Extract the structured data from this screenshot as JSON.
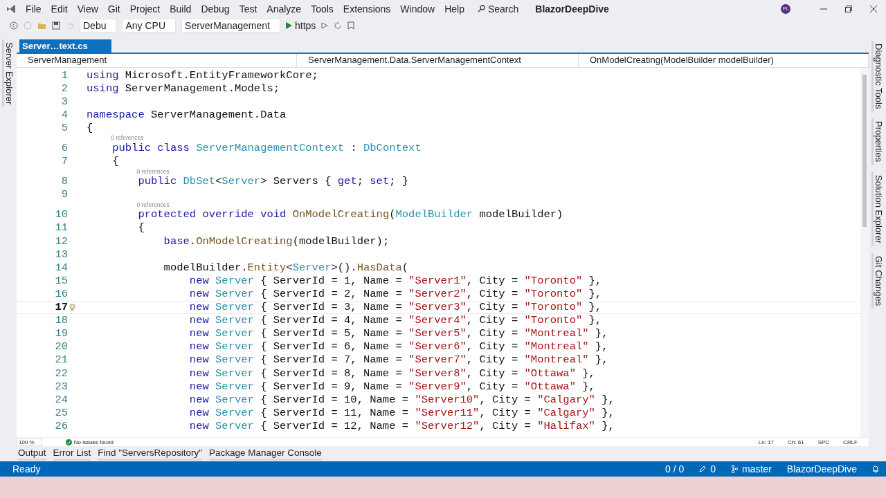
{
  "menu_bar": {
    "items": [
      "File",
      "Edit",
      "View",
      "Git",
      "Project",
      "Build",
      "Debug",
      "Test",
      "Analyze",
      "Tools",
      "Extensions",
      "Window",
      "Help"
    ],
    "search": "Search",
    "solution": "BlazorDeepDive",
    "avatar": "FL"
  },
  "toolbar": {
    "configuration": "Debu",
    "platform": "Any CPU",
    "startup_project": "ServerManagement",
    "run_profile": "https"
  },
  "left_tabs": [
    "Server Explorer"
  ],
  "document_tabs": [
    {
      "label": "Server…text.cs",
      "selected": true
    }
  ],
  "navigation_bar": [
    "ServerManagement",
    "ServerManagement.Data.ServerManagementContext",
    "OnModelCreating(ModelBuilder modelBuilder)"
  ],
  "editor": {
    "lines": [
      {
        "number": "1",
        "current": false,
        "tokens": [
          {
            "kind": "kw",
            "t": "using"
          },
          {
            "kind": "plain",
            "t": " Microsoft.EntityFrameworkCore;"
          }
        ]
      },
      {
        "number": "2",
        "current": false,
        "tokens": [
          {
            "kind": "kw",
            "t": "using"
          },
          {
            "kind": "plain",
            "t": " ServerManagement.Models;"
          }
        ]
      },
      {
        "number": "3",
        "current": false
      },
      {
        "number": "4",
        "current": false,
        "tokens": [
          {
            "kind": "kw",
            "t": "namespace"
          },
          {
            "kind": "plain",
            "t": " ServerManagement.Data"
          }
        ]
      },
      {
        "number": "5",
        "current": false,
        "tokens": [
          {
            "kind": "plain",
            "t": "{"
          }
        ]
      },
      {
        "number": "6",
        "current": false,
        "codelens": "0 references",
        "tokens": [
          {
            "kind": "kw",
            "t": "    public class "
          },
          {
            "kind": "type",
            "t": "ServerManagementContext"
          },
          {
            "kind": "plain",
            "t": " : "
          },
          {
            "kind": "type",
            "t": "DbContext"
          }
        ]
      },
      {
        "number": "7",
        "current": false,
        "tokens": [
          {
            "kind": "plain",
            "t": "    {"
          }
        ]
      },
      {
        "number": "8",
        "current": false,
        "codelens": "0 references",
        "tokens": [
          {
            "kind": "kw",
            "t": "        public "
          },
          {
            "kind": "type",
            "t": "DbSet"
          },
          {
            "kind": "plain",
            "t": "<"
          },
          {
            "kind": "type",
            "t": "Server"
          },
          {
            "kind": "plain",
            "t": "> Servers { "
          },
          {
            "kind": "kw",
            "t": "get"
          },
          {
            "kind": "plain",
            "t": "; "
          },
          {
            "kind": "kw",
            "t": "set"
          },
          {
            "kind": "plain",
            "t": "; }"
          }
        ]
      },
      {
        "number": "9",
        "current": false
      },
      {
        "number": "10",
        "current": false,
        "codelens": "0 references",
        "tokens": [
          {
            "kind": "kw",
            "t": "        protected override void "
          },
          {
            "kind": "method",
            "t": "OnModelCreating"
          },
          {
            "kind": "plain",
            "t": "("
          },
          {
            "kind": "type",
            "t": "ModelBuilder"
          },
          {
            "kind": "plain",
            "t": " modelBuilder)"
          }
        ]
      },
      {
        "number": "11",
        "current": false,
        "tokens": [
          {
            "kind": "plain",
            "t": "        {"
          }
        ]
      },
      {
        "number": "12",
        "current": false,
        "tokens": [
          {
            "kind": "kw",
            "t": "            base"
          },
          {
            "kind": "plain",
            "t": "."
          },
          {
            "kind": "method",
            "t": "OnModelCreating"
          },
          {
            "kind": "plain",
            "t": "(modelBuilder);"
          }
        ]
      },
      {
        "number": "13",
        "current": false
      },
      {
        "number": "14",
        "current": false,
        "tokens": [
          {
            "kind": "plain",
            "t": "            modelBuilder."
          },
          {
            "kind": "method",
            "t": "Entity"
          },
          {
            "kind": "plain",
            "t": "<"
          },
          {
            "kind": "type",
            "t": "Server"
          },
          {
            "kind": "plain",
            "t": ">()."
          },
          {
            "kind": "method",
            "t": "HasData"
          },
          {
            "kind": "plain",
            "t": "("
          }
        ]
      },
      {
        "number": "15",
        "current": false,
        "tokens": [
          {
            "kind": "kw",
            "t": "                new "
          },
          {
            "kind": "type",
            "t": "Server"
          },
          {
            "kind": "plain",
            "t": " { ServerId = 1, Name = "
          },
          {
            "kind": "str",
            "t": "\"Server1\""
          },
          {
            "kind": "plain",
            "t": ", City = "
          },
          {
            "kind": "str",
            "t": "\"Toronto\""
          },
          {
            "kind": "plain",
            "t": " },"
          }
        ]
      },
      {
        "number": "16",
        "current": false,
        "tokens": [
          {
            "kind": "kw",
            "t": "                new "
          },
          {
            "kind": "type",
            "t": "Server"
          },
          {
            "kind": "plain",
            "t": " { ServerId = 2, Name = "
          },
          {
            "kind": "str",
            "t": "\"Server2\""
          },
          {
            "kind": "plain",
            "t": ", City = "
          },
          {
            "kind": "str",
            "t": "\"Toronto\""
          },
          {
            "kind": "plain",
            "t": " },"
          }
        ]
      },
      {
        "number": "17",
        "current": true,
        "tokens": [
          {
            "kind": "kw",
            "t": "                new "
          },
          {
            "kind": "type",
            "t": "Server"
          },
          {
            "kind": "plain",
            "t": " { ServerId = 3, Name = "
          },
          {
            "kind": "str",
            "t": "\"Server3\""
          },
          {
            "kind": "plain",
            "t": ", City = "
          },
          {
            "kind": "str",
            "t": "\"Toronto\""
          },
          {
            "kind": "plain",
            "t": " },"
          }
        ]
      },
      {
        "number": "18",
        "current": false,
        "tokens": [
          {
            "kind": "kw",
            "t": "                new "
          },
          {
            "kind": "type",
            "t": "Server"
          },
          {
            "kind": "plain",
            "t": " { ServerId = 4, Name = "
          },
          {
            "kind": "str",
            "t": "\"Server4\""
          },
          {
            "kind": "plain",
            "t": ", City = "
          },
          {
            "kind": "str",
            "t": "\"Toronto\""
          },
          {
            "kind": "plain",
            "t": " },"
          }
        ]
      },
      {
        "number": "19",
        "current": false,
        "tokens": [
          {
            "kind": "kw",
            "t": "                new "
          },
          {
            "kind": "type",
            "t": "Server"
          },
          {
            "kind": "plain",
            "t": " { ServerId = 5, Name = "
          },
          {
            "kind": "str",
            "t": "\"Server5\""
          },
          {
            "kind": "plain",
            "t": ", City = "
          },
          {
            "kind": "str",
            "t": "\"Montreal\""
          },
          {
            "kind": "plain",
            "t": " },"
          }
        ]
      },
      {
        "number": "20",
        "current": false,
        "tokens": [
          {
            "kind": "kw",
            "t": "                new "
          },
          {
            "kind": "type",
            "t": "Server"
          },
          {
            "kind": "plain",
            "t": " { ServerId = 6, Name = "
          },
          {
            "kind": "str",
            "t": "\"Server6\""
          },
          {
            "kind": "plain",
            "t": ", City = "
          },
          {
            "kind": "str",
            "t": "\"Montreal\""
          },
          {
            "kind": "plain",
            "t": " },"
          }
        ]
      },
      {
        "number": "21",
        "current": false,
        "tokens": [
          {
            "kind": "kw",
            "t": "                new "
          },
          {
            "kind": "type",
            "t": "Server"
          },
          {
            "kind": "plain",
            "t": " { ServerId = 7, Name = "
          },
          {
            "kind": "str",
            "t": "\"Server7\""
          },
          {
            "kind": "plain",
            "t": ", City = "
          },
          {
            "kind": "str",
            "t": "\"Montreal\""
          },
          {
            "kind": "plain",
            "t": " },"
          }
        ]
      },
      {
        "number": "22",
        "current": false,
        "tokens": [
          {
            "kind": "kw",
            "t": "                new "
          },
          {
            "kind": "type",
            "t": "Server"
          },
          {
            "kind": "plain",
            "t": " { ServerId = 8, Name = "
          },
          {
            "kind": "str",
            "t": "\"Server8\""
          },
          {
            "kind": "plain",
            "t": ", City = "
          },
          {
            "kind": "str",
            "t": "\"Ottawa\""
          },
          {
            "kind": "plain",
            "t": " },"
          }
        ]
      },
      {
        "number": "23",
        "current": false,
        "tokens": [
          {
            "kind": "kw",
            "t": "                new "
          },
          {
            "kind": "type",
            "t": "Server"
          },
          {
            "kind": "plain",
            "t": " { ServerId = 9, Name = "
          },
          {
            "kind": "str",
            "t": "\"Server9\""
          },
          {
            "kind": "plain",
            "t": ", City = "
          },
          {
            "kind": "str",
            "t": "\"Ottawa\""
          },
          {
            "kind": "plain",
            "t": " },"
          }
        ]
      },
      {
        "number": "24",
        "current": false,
        "tokens": [
          {
            "kind": "kw",
            "t": "                new "
          },
          {
            "kind": "type",
            "t": "Server"
          },
          {
            "kind": "plain",
            "t": " { ServerId = 10, Name = "
          },
          {
            "kind": "str",
            "t": "\"Server10\""
          },
          {
            "kind": "plain",
            "t": ", City = "
          },
          {
            "kind": "str",
            "t": "\"Calgary\""
          },
          {
            "kind": "plain",
            "t": " },"
          }
        ]
      },
      {
        "number": "25",
        "current": false,
        "tokens": [
          {
            "kind": "kw",
            "t": "                new "
          },
          {
            "kind": "type",
            "t": "Server"
          },
          {
            "kind": "plain",
            "t": " { ServerId = 11, Name = "
          },
          {
            "kind": "str",
            "t": "\"Server11\""
          },
          {
            "kind": "plain",
            "t": ", City = "
          },
          {
            "kind": "str",
            "t": "\"Calgary\""
          },
          {
            "kind": "plain",
            "t": " },"
          }
        ]
      },
      {
        "number": "26",
        "current": false,
        "tokens": [
          {
            "kind": "kw",
            "t": "                new "
          },
          {
            "kind": "type",
            "t": "Server"
          },
          {
            "kind": "plain",
            "t": " { ServerId = 12, Name = "
          },
          {
            "kind": "str",
            "t": "\"Server12\""
          },
          {
            "kind": "plain",
            "t": ", City = "
          },
          {
            "kind": "str",
            "t": "\"Halifax\""
          },
          {
            "kind": "plain",
            "t": " },"
          }
        ]
      }
    ]
  },
  "editor_status": {
    "zoom": "100 %",
    "issues": "No issues found",
    "position": [
      "Ln: 17",
      "Ch: 61",
      "SPC",
      "CRLF"
    ]
  },
  "right_tabs": [
    "Diagnostic Tools",
    "Properties",
    "Solution Explorer",
    "Git Changes"
  ],
  "tool_tabs": [
    "Output",
    "Error List",
    "Find \"ServersRepository\"",
    "Package Manager Console"
  ],
  "status_bar": {
    "state": "Ready",
    "sync": "0 / 0",
    "changes": "0",
    "branch": "master",
    "repository": "BlazorDeepDive"
  }
}
